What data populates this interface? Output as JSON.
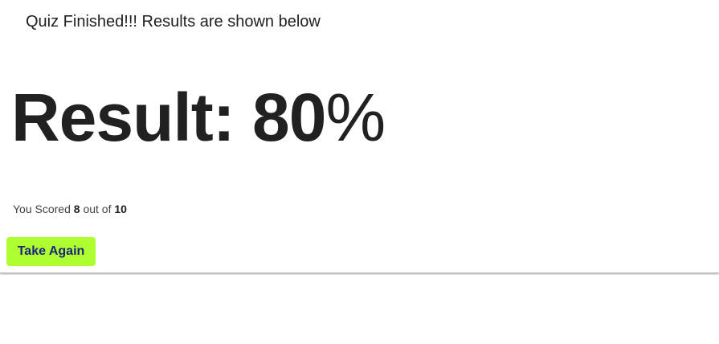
{
  "header": {
    "text": "Quiz Finished!!! Results are shown below"
  },
  "result": {
    "label": "Result:",
    "value": "80",
    "unit": "%"
  },
  "score": {
    "prefix": "You Scored",
    "correct": "8",
    "middle": "out of",
    "total": "10"
  },
  "actions": {
    "take_again_label": "Take Again"
  },
  "colors": {
    "accent": "#adff2f",
    "button_text": "#1a237e",
    "text": "#212121"
  }
}
